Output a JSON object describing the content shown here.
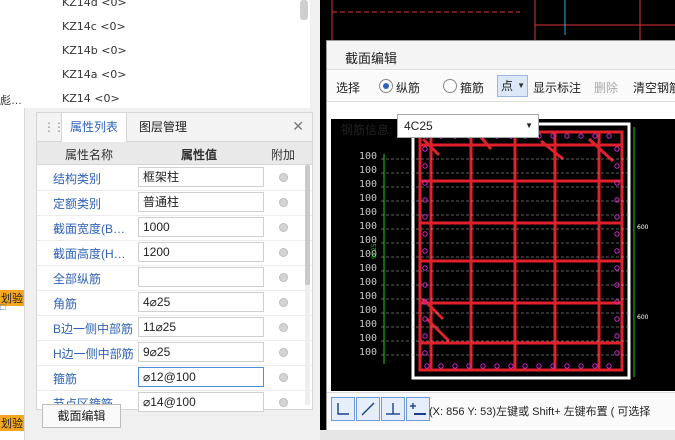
{
  "left_edge": {
    "frag1": "彪…",
    "frag2": "划验",
    "frag3": "划验"
  },
  "tree": {
    "items": [
      "KZ14d <0>",
      "KZ14c <0>",
      "KZ14b <0>",
      "KZ14a <0>",
      "KZ14 <0>"
    ]
  },
  "panel": {
    "tab_props": "属性列表",
    "tab_layers": "图层管理",
    "col_name": "属性名称",
    "col_value": "属性值",
    "col_extra": "附加",
    "rows": [
      {
        "name": "结构类别",
        "value": "框架柱"
      },
      {
        "name": "定额类别",
        "value": "普通柱"
      },
      {
        "name": "截面宽度(B…",
        "value": "1000"
      },
      {
        "name": "截面高度(H…",
        "value": "1200"
      },
      {
        "name": "全部纵筋",
        "value": ""
      },
      {
        "name": "角筋",
        "value": "4⌀25"
      },
      {
        "name": "B边一侧中部筋",
        "value": "11⌀25"
      },
      {
        "name": "H边一侧中部筋",
        "value": "9⌀25"
      },
      {
        "name": "箍筋",
        "value": "⌀12@100"
      },
      {
        "name": "节点区箍筋",
        "value": "⌀14@100"
      }
    ],
    "section_edit_button": "截面编辑"
  },
  "dialog": {
    "title": "截面编辑",
    "toolbar": {
      "select": "选择",
      "longitudinal": "纵筋",
      "stirrup": "箍筋",
      "point": "点",
      "show_labels": "显示标注",
      "delete": "删除",
      "clear": "清空钢筋"
    },
    "rebar_info_label": "钢筋信息:",
    "rebar_info_value": "4C25",
    "hint": "(X: 856 Y: 53)左键或 Shift+ 左键布置 ( 可选择"
  },
  "drawing": {
    "dim_left": "100",
    "dim_side": "9C25",
    "dim_right_top": "600",
    "dim_right_bottom": "600"
  },
  "colors": {
    "accent": "#2f63b8",
    "rebar_red": "#e0202a",
    "dim_green": "#17d117",
    "cad_bg": "#000000"
  }
}
